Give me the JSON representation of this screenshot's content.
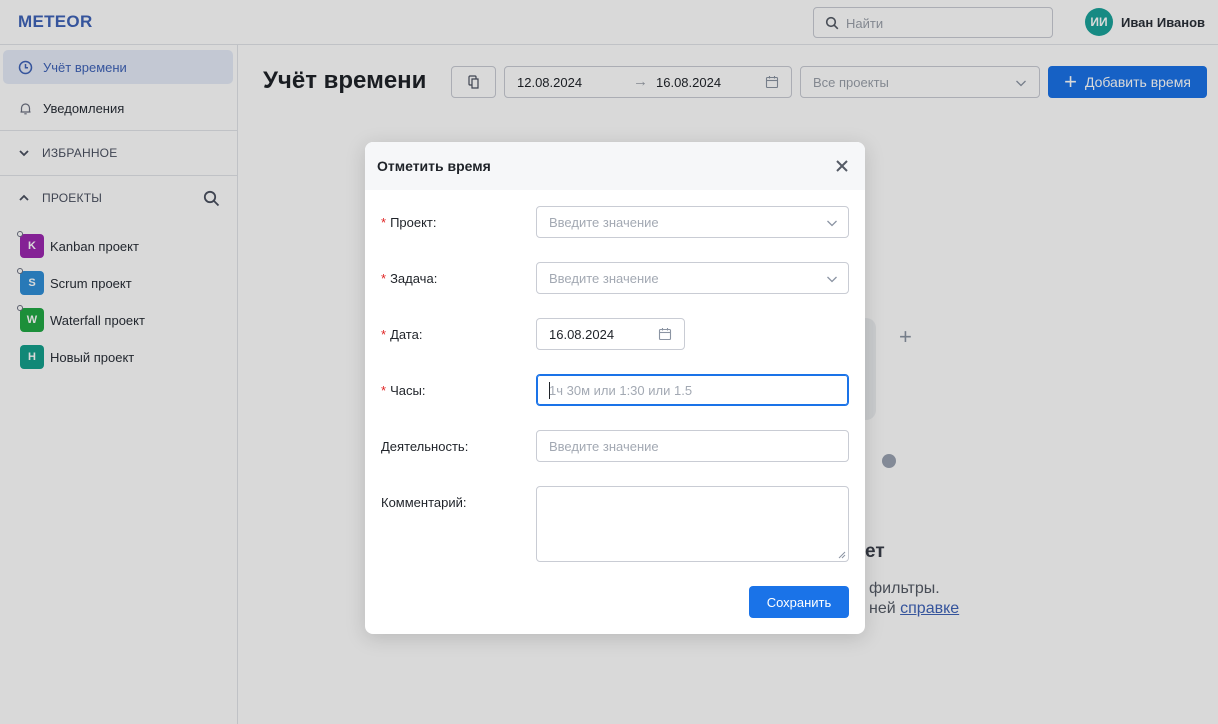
{
  "app": {
    "logo": "METEOR"
  },
  "header": {
    "search_placeholder": "Найти",
    "user": {
      "initials": "ИИ",
      "name": "Иван Иванов",
      "avatar_color": "#1aa39b"
    }
  },
  "sidebar": {
    "nav": [
      {
        "label": "Учёт времени",
        "icon": "clock-icon",
        "active": true
      },
      {
        "label": "Уведомления",
        "icon": "bell-icon",
        "active": false
      }
    ],
    "favorites_label": "ИЗБРАННОЕ",
    "projects_label": "ПРОЕКТЫ",
    "projects": [
      {
        "letter": "K",
        "name": "Kanban проект",
        "color": "#9c27b0"
      },
      {
        "letter": "S",
        "name": "Scrum проект",
        "color": "#2f8fd8"
      },
      {
        "letter": "W",
        "name": "Waterfall проект",
        "color": "#22a845"
      },
      {
        "letter": "Н",
        "name": "Новый проект",
        "color": "#14a08c"
      }
    ]
  },
  "main": {
    "title": "Учёт времени",
    "date_from": "12.08.2024",
    "date_arrow": "→",
    "date_to": "16.08.2024",
    "project_filter_placeholder": "Все проекты",
    "add_button": "Добавить время",
    "empty": {
      "title_fragment": "ет",
      "text_line1": "фильтры.",
      "text_line2_prefix": "ней",
      "text_line2_link": "справке"
    }
  },
  "modal": {
    "title": "Отметить время",
    "fields": {
      "project": {
        "label": "Проект",
        "placeholder": "Введите значение",
        "required": true
      },
      "task": {
        "label": "Задача",
        "placeholder": "Введите значение",
        "required": true
      },
      "date": {
        "label": "Дата",
        "value": "16.08.2024",
        "required": true
      },
      "hours": {
        "label": "Часы",
        "placeholder": "1ч 30м или 1:30 или 1.5",
        "required": true
      },
      "activity": {
        "label": "Деятельность",
        "placeholder": "Введите значение",
        "required": false
      },
      "comment": {
        "label": "Комментарий",
        "required": false
      }
    },
    "label_suffix": ":",
    "required_mark": "*",
    "save_button": "Сохранить"
  },
  "colors": {
    "accent": "#1a73e8",
    "brand": "#3f63b8",
    "required": "#e02424"
  }
}
